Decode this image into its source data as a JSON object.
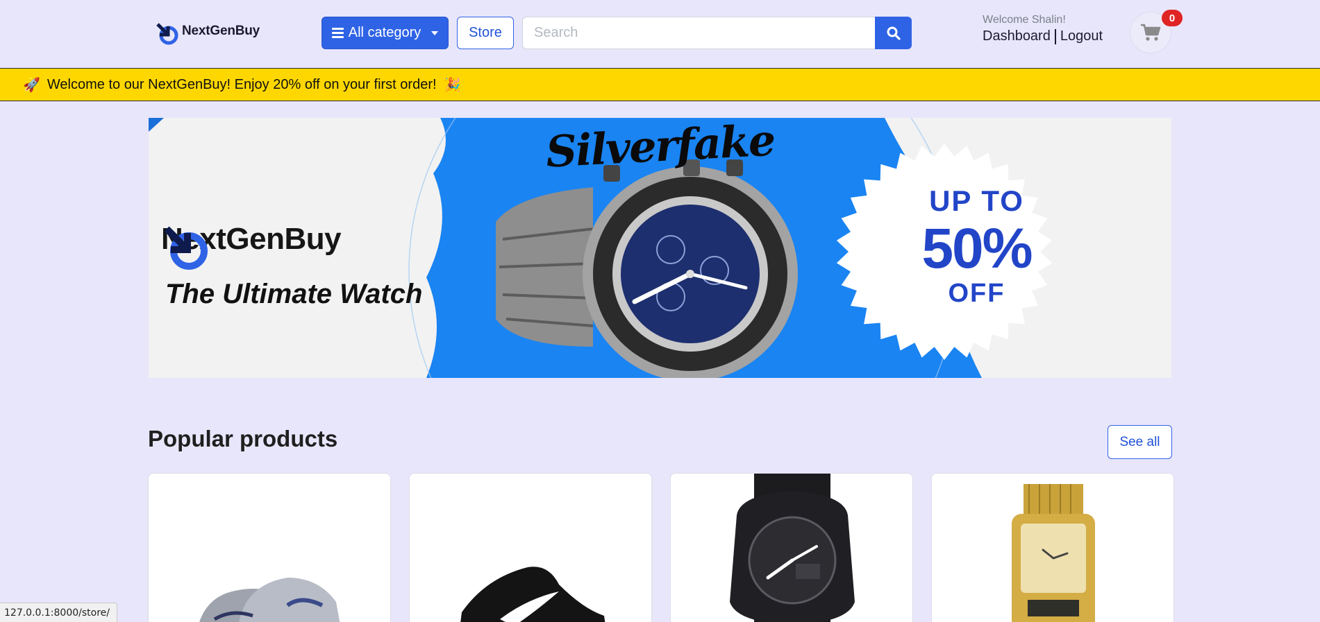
{
  "header": {
    "logo_text": "NextGenBuy",
    "category_label": "All category",
    "store_label": "Store",
    "search_placeholder": "Search",
    "welcome_text": "Welcome Shalin!",
    "dashboard_label": "Dashboard",
    "logout_label": "Logout",
    "cart_count": "0",
    "icons": [
      "logo-icon",
      "menu-icon",
      "chevron-down-icon",
      "search-icon",
      "cart-icon"
    ]
  },
  "announcement": {
    "text": "Welcome to our NextGenBuy! Enjoy 20% off on your first order!",
    "leading_emoji": "🚀",
    "trailing_emoji": "🎉"
  },
  "banner": {
    "logo_text": "NextGenBuy",
    "tagline": "The Ultimate Watch",
    "brand": "Silverfake",
    "promo_line1": "UP TO",
    "promo_line2": "50%",
    "promo_line3": "OFF"
  },
  "popular": {
    "title": "Popular products",
    "see_all_label": "See all",
    "products": [
      {
        "image": "grey-running-sneakers"
      },
      {
        "image": "black-low-top-sneaker"
      },
      {
        "image": "black-gshock-watch"
      },
      {
        "image": "gold-digital-watch"
      }
    ]
  },
  "status_url": "127.0.0.1:8000/store/",
  "colors": {
    "primary": "#2f63e6",
    "background": "#e8e6fb",
    "announcement": "#ffd700",
    "badge": "#e02424",
    "banner_blue": "#1a84f2"
  }
}
